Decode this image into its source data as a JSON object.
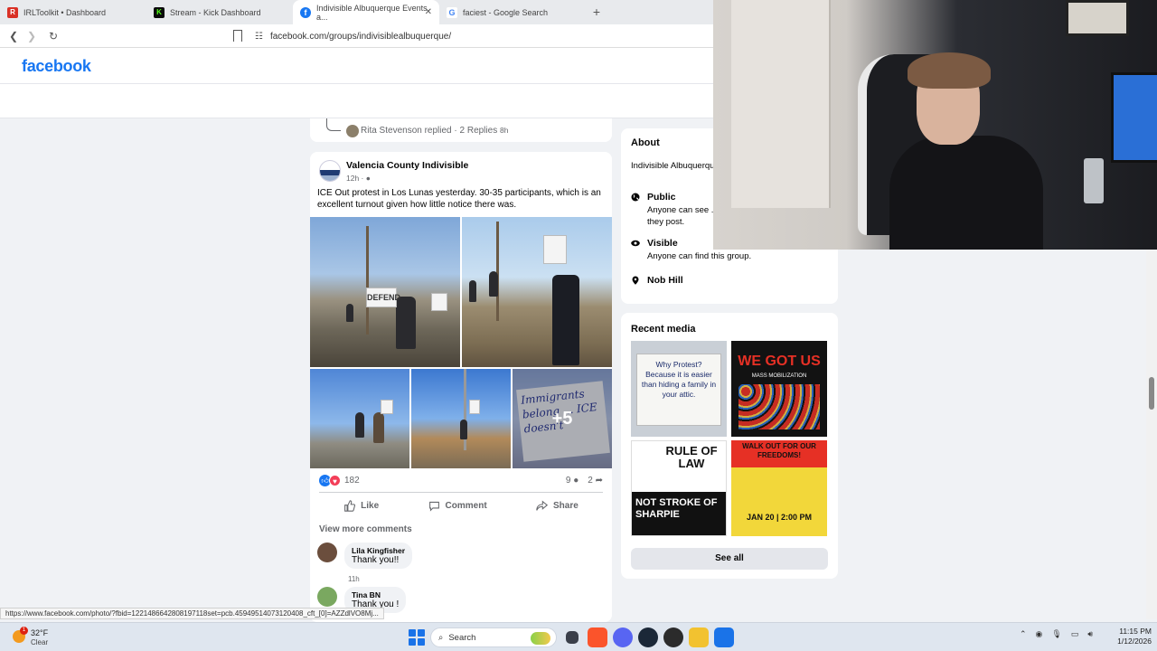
{
  "browser": {
    "tabs": [
      {
        "label": "IRLToolkit • Dashboard",
        "favicon_color": "#d93025",
        "favicon_letter": "R"
      },
      {
        "label": "Stream - Kick Dashboard",
        "favicon_color": "#53fc18",
        "favicon_letter": "K"
      },
      {
        "label": "Indivisible Albuquerque Events a...",
        "favicon_color": "#1877f2",
        "favicon_letter": "f"
      },
      {
        "label": "faciest - Google Search",
        "favicon_color": "#4285f4",
        "favicon_letter": "G"
      }
    ],
    "url": "facebook.com/groups/indivisiblealbuquerque/"
  },
  "header": {
    "logo": "facebook"
  },
  "previous_post": {
    "reply_text": "Rita Stevenson replied · 2 Replies",
    "reply_time": "8h"
  },
  "post": {
    "author": "Valencia County Indivisible",
    "time": "12h ·",
    "text": "ICE Out protest in Los Lunas yesterday. 30-35 participants, which is an excellent turnout given how little notice there was.",
    "more_photos": "+5",
    "sign_text_1": "DEFEND",
    "sign_text_5": "Immigrants belong ... ICE doesn't",
    "reaction_count": "182",
    "comment_count": "9",
    "share_count": "2",
    "actions": {
      "like": "Like",
      "comment": "Comment",
      "share": "Share"
    },
    "view_more": "View more comments",
    "comments": [
      {
        "name": "Lila Kingfisher",
        "text": "Thank you!!",
        "time": "11h",
        "avatar_color": "#6b4e3d"
      },
      {
        "name": "Tina BN",
        "text": "Thank you !",
        "avatar_color": "#7aa860"
      }
    ]
  },
  "about": {
    "title": "About",
    "description": "Indivisible Albuquerque ... values and actions in",
    "rows": [
      {
        "title": "Public",
        "sub1": "Anyone can see ...",
        "sub2": "they post.",
        "icon": "globe-icon"
      },
      {
        "title": "Visible",
        "sub1": "Anyone can find this group.",
        "icon": "eye-icon"
      },
      {
        "title": "Nob Hill",
        "icon": "location-pin-icon"
      }
    ]
  },
  "recent_media": {
    "title": "Recent media",
    "tiles": [
      {
        "text": "Why Protest? Because it is easier than hiding a family in your attic."
      },
      {
        "text": "WE GOT US",
        "sub": "MASS MOBILIZATION"
      },
      {
        "text": "RULE OF LAW",
        "sub": "NOT STROKE OF SHARPIE"
      },
      {
        "text": "WALK OUT FOR OUR FREEDOMS!",
        "sub": "JAN 20 | 2:00 PM"
      }
    ],
    "see_all": "See all"
  },
  "status_url": "https://www.facebook.com/photo/?fbid=1221486642808197118set=pcb.45949514073120408_cft_[0]=AZZdlVO8Mj...",
  "taskbar": {
    "temperature": "32°F",
    "condition": "Clear",
    "weather_badge": "1",
    "search_label": "Search",
    "time": "11:15 PM",
    "date": "1/12/2026"
  }
}
